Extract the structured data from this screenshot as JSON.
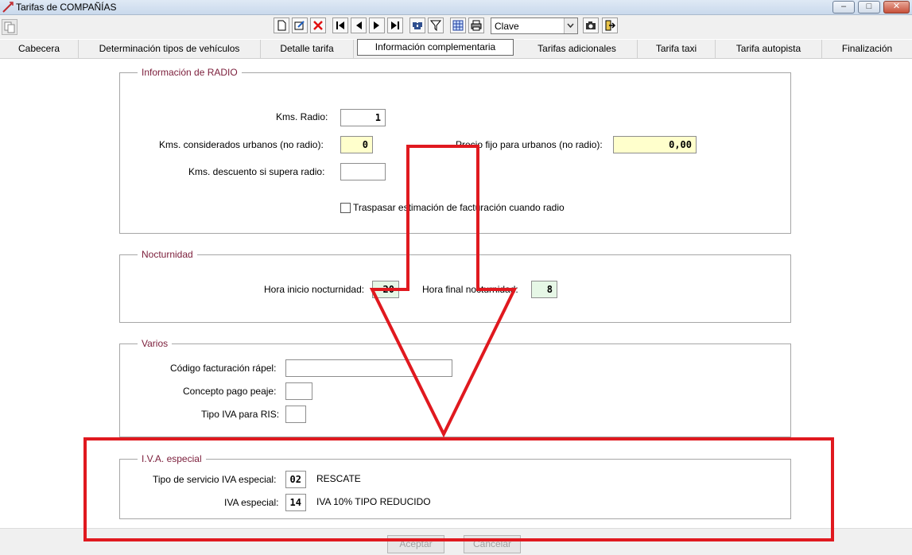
{
  "window": {
    "title": "Tarifas de COMPAÑÍAS",
    "minimize": "–",
    "maximize": "□",
    "close": "✕"
  },
  "toolbar": {
    "search_combo_value": "Clave"
  },
  "tabs": [
    {
      "label": "Cabecera"
    },
    {
      "label": "Determinación tipos de vehículos"
    },
    {
      "label": "Detalle tarifa"
    },
    {
      "label": "Información complementaria"
    },
    {
      "label": "Tarifas adicionales"
    },
    {
      "label": "Tarifa taxi"
    },
    {
      "label": "Tarifa autopista"
    },
    {
      "label": "Finalización"
    }
  ],
  "radio": {
    "legend": "Información de RADIO",
    "kms_radio_label": "Kms. Radio:",
    "kms_radio_value": "1",
    "kms_urbanos_label": "Kms. considerados urbanos (no radio):",
    "kms_urbanos_value": "0",
    "precio_fijo_label": "Precio fijo para urbanos (no radio):",
    "precio_fijo_value": "0,00",
    "kms_descuento_label": "Kms. descuento si supera radio:",
    "kms_descuento_value": "",
    "traspasar_label": "Traspasar estimación de facturación cuando radio"
  },
  "nocturnidad": {
    "legend": "Nocturnidad",
    "inicio_label": "Hora inicio nocturnidad:",
    "inicio_value": "20",
    "final_label": "Hora final nocturnidad:",
    "final_value": "8"
  },
  "varios": {
    "legend": "Varios",
    "codigo_label": "Código facturación rápel:",
    "codigo_value": "",
    "concepto_label": "Concepto pago peaje:",
    "concepto_value": "",
    "tipo_iva_label": "Tipo IVA para RIS:",
    "tipo_iva_value": ""
  },
  "iva_especial": {
    "legend": "I.V.A. especial",
    "tipo_servicio_label": "Tipo de servicio IVA especial:",
    "tipo_servicio_value": "02",
    "tipo_servicio_desc": "RESCATE",
    "iva_label": "IVA especial:",
    "iva_value": "14",
    "iva_desc": "IVA 10% TIPO REDUCIDO"
  },
  "footer": {
    "accept_label": "Aceptar",
    "cancel_label": "Cancelar"
  },
  "annotation_color": "#e0191f"
}
